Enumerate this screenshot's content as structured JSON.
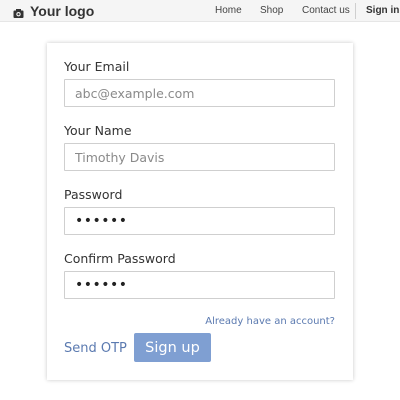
{
  "header": {
    "logo_text": "Your logo",
    "logo_icon": "camera-icon",
    "nav": {
      "home": "Home",
      "shop": "Shop",
      "contact": "Contact us",
      "signin": "Sign in"
    }
  },
  "form": {
    "email": {
      "label": "Your Email",
      "placeholder": "abc@example.com",
      "value": ""
    },
    "name": {
      "label": "Your Name",
      "placeholder": "Timothy Davis",
      "value": ""
    },
    "password": {
      "label": "Password",
      "value": "••••••"
    },
    "confirm_password": {
      "label": "Confirm Password",
      "value": "••••••"
    },
    "already_account_link": "Already have an account?",
    "send_otp_link": "Send OTP",
    "signup_button": "Sign up"
  },
  "colors": {
    "accent_link": "#5b7ab0",
    "button_bg": "#7f9fd2",
    "topbar_bg": "#f5f5f5"
  }
}
